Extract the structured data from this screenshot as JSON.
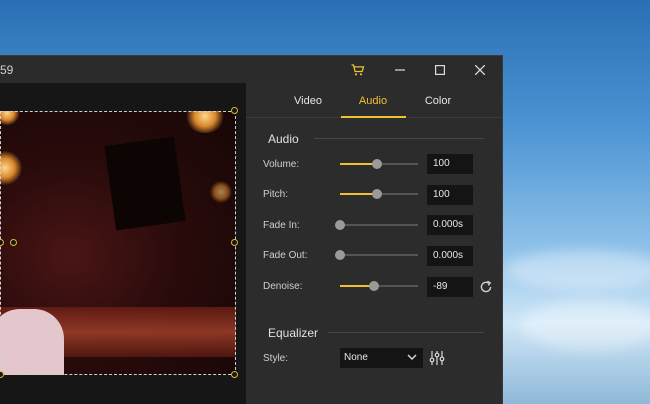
{
  "window": {
    "title": "59"
  },
  "titlebar": {
    "cart_icon": "cart-icon",
    "minimize_icon": "minimize-icon",
    "maximize_icon": "maximize-icon",
    "close_icon": "close-icon"
  },
  "tabs": [
    {
      "label": "Video",
      "active": false
    },
    {
      "label": "Audio",
      "active": true
    },
    {
      "label": "Color",
      "active": false
    }
  ],
  "audio": {
    "section_title": "Audio",
    "rows": [
      {
        "label": "Volume:",
        "value": "100",
        "level": 0.5
      },
      {
        "label": "Pitch:",
        "value": "100",
        "level": 0.5
      },
      {
        "label": "Fade In:",
        "value": "0.000s",
        "level": 0.0
      },
      {
        "label": "Fade Out:",
        "value": "0.000s",
        "level": 0.0
      },
      {
        "label": "Denoise:",
        "value": "-89",
        "level": 0.44
      }
    ],
    "reset_icon": "reset-icon"
  },
  "equalizer": {
    "section_title": "Equalizer",
    "style_label": "Style:",
    "style_value": "None",
    "settings_icon": "equalizer-icon"
  },
  "colors": {
    "accent": "#f0c230",
    "panel_bg": "#2c2c2c",
    "field_bg": "#141414"
  }
}
